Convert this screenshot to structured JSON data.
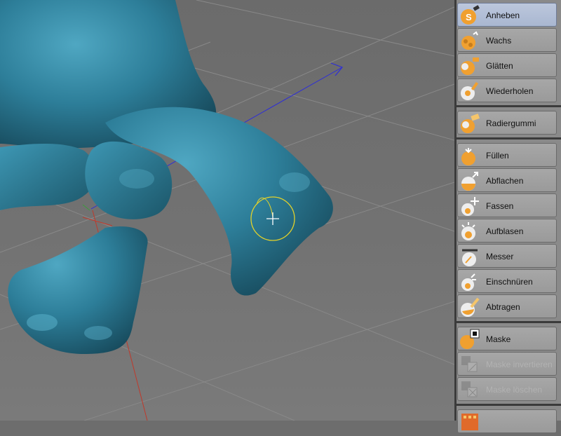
{
  "viewport": {
    "object_color": "#2e7f9b",
    "brush_cursor_color": "#e3d22a",
    "grid_color": "#8a8a8a",
    "axis_colors": {
      "x": "#c0392b",
      "z": "#2d2dd8",
      "y": "#3c9c3c"
    }
  },
  "tools": {
    "group1": [
      {
        "label": "Anheben",
        "icon": "anheben-brush-icon",
        "active": true
      },
      {
        "label": "Wachs",
        "icon": "wachs-brush-icon"
      },
      {
        "label": "Glätten",
        "icon": "glaetten-brush-icon"
      },
      {
        "label": "Wiederholen",
        "icon": "wiederholen-brush-icon"
      }
    ],
    "group2": [
      {
        "label": "Radiergummi",
        "icon": "radiergummi-brush-icon"
      }
    ],
    "group3": [
      {
        "label": "Füllen",
        "icon": "fuellen-brush-icon"
      },
      {
        "label": "Abflachen",
        "icon": "abflachen-brush-icon"
      },
      {
        "label": "Fassen",
        "icon": "fassen-brush-icon"
      },
      {
        "label": "Aufblasen",
        "icon": "aufblasen-brush-icon"
      },
      {
        "label": "Messer",
        "icon": "messer-brush-icon"
      },
      {
        "label": "Einschnüren",
        "icon": "einschnueren-brush-icon"
      },
      {
        "label": "Abtragen",
        "icon": "abtragen-brush-icon"
      }
    ],
    "group4": [
      {
        "label": "Maske",
        "icon": "maske-brush-icon"
      },
      {
        "label": "Maske invertieren",
        "icon": "maske-invertieren-icon",
        "disabled": true
      },
      {
        "label": "Maske löschen",
        "icon": "maske-loeschen-icon",
        "disabled": true
      }
    ]
  },
  "accent": "#f0a030",
  "active_color": "#aebbd4"
}
